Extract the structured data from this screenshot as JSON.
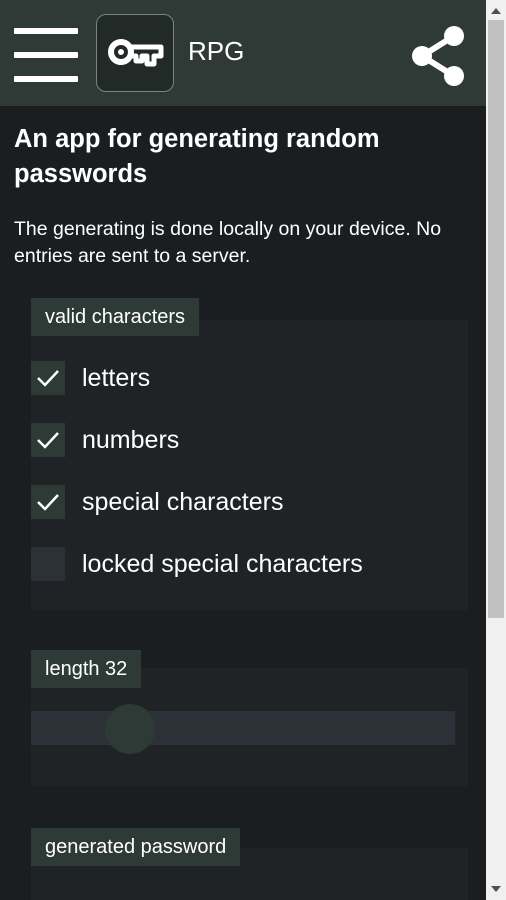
{
  "header": {
    "menu_icon": "hamburger-menu-icon",
    "logo_icon": "key-icon",
    "title": "RPG",
    "share_icon": "share-icon",
    "background": "#2f3a37"
  },
  "main": {
    "headline": "An app for generating random passwords",
    "intro": "The generating is done locally on your device. No entries are sent to a server."
  },
  "characters": {
    "label": "valid characters",
    "options": [
      {
        "label": "letters",
        "checked": true
      },
      {
        "label": "numbers",
        "checked": true
      },
      {
        "label": "special characters",
        "checked": true
      },
      {
        "label": "locked special characters",
        "checked": false
      }
    ]
  },
  "length": {
    "label": "length 32",
    "value": 32
  },
  "output": {
    "label": "generated password"
  },
  "colors": {
    "page_background": "#1b1e21",
    "accent": "#2e3a36",
    "check_mark": "#ffffff"
  }
}
